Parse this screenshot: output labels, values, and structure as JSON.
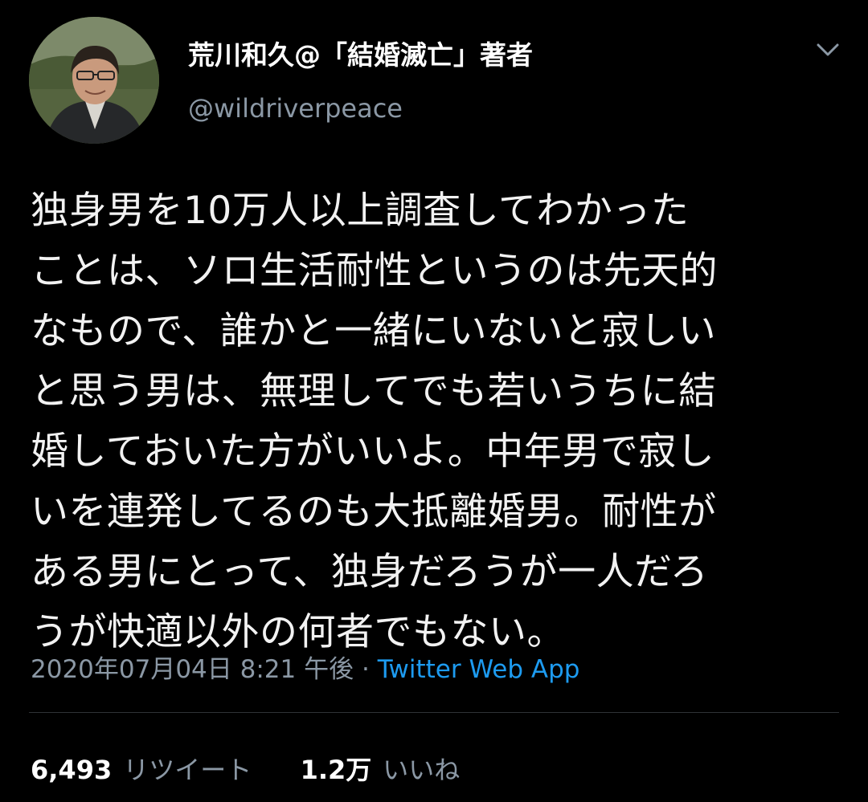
{
  "author": {
    "display_name": "荒川和久@「結婚滅亡」著者",
    "handle": "@wildriverpeace"
  },
  "tweet": {
    "lines": [
      "独身男を10万人以上調査してわかった",
      "ことは、ソロ生活耐性というのは先天的",
      "なもので、誰かと一緒にいないと寂しい",
      "と思う男は、無理してでも若いうちに結",
      "婚しておいた方がいいよ。中年男で寂し",
      "いを連発してるのも大抵離婚男。耐性が",
      "ある男にとって、独身だろうが一人だろ",
      "うが快適以外の何者でもない。"
    ],
    "timestamp": "2020年07月04日 8:21 午後",
    "separator": "·",
    "source": "Twitter Web App"
  },
  "stats": {
    "retweets": {
      "count": "6,493",
      "label": "リツイート"
    },
    "likes": {
      "count": "1.2万",
      "label": "いいね"
    }
  },
  "icons": {
    "menu": "chevron-down-icon",
    "avatar": "profile-photo"
  },
  "colors": {
    "background": "#000000",
    "text": "#ffffff",
    "secondary_text": "#8b98a5",
    "link": "#1d9bf0",
    "divider": "#2f3336"
  }
}
